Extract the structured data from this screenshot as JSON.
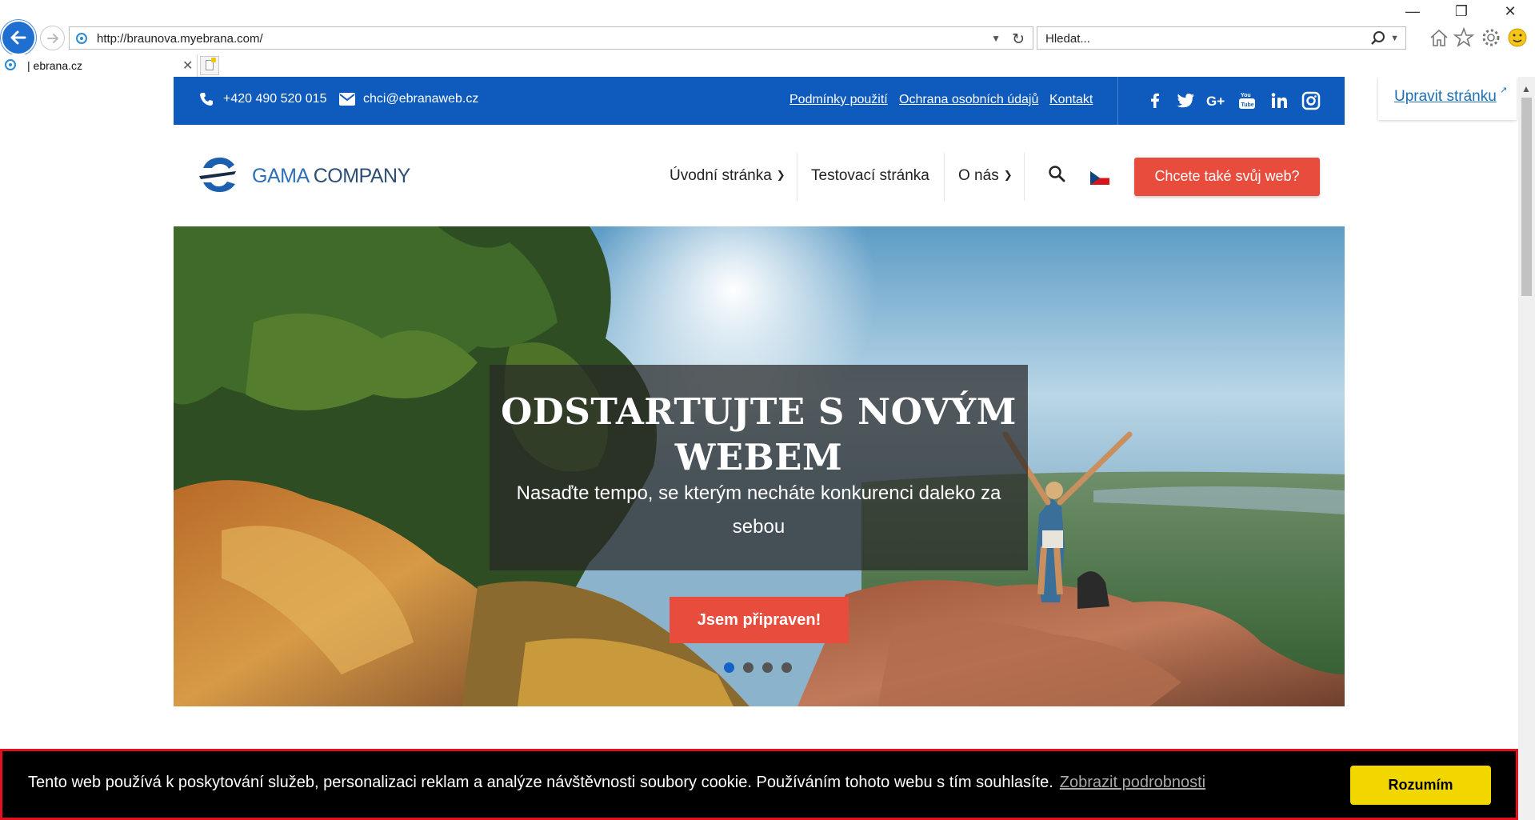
{
  "browser": {
    "url": "http://braunova.myebrana.com/",
    "search_placeholder": "Hledat...",
    "tab_title": "| ebrana.cz"
  },
  "edit_page": {
    "label": "Upravit stránku"
  },
  "topbar": {
    "phone": "+420 490 520 015",
    "email": "chci@ebranaweb.cz",
    "links": [
      "Podmínky použití",
      "Ochrana osobních údajů",
      "Kontakt"
    ],
    "social": [
      "facebook-icon",
      "twitter-icon",
      "google-plus-icon",
      "youtube-icon",
      "linkedin-icon",
      "instagram-icon"
    ]
  },
  "header": {
    "logo_text_1": "GAMA",
    "logo_text_2": " COMPANY",
    "nav": [
      "Úvodní stránka",
      "Testovací stránka",
      "O nás"
    ],
    "cta": "Chcete také svůj web?"
  },
  "hero": {
    "title": "ODSTARTUJTE S NOVÝM WEBEM",
    "subtitle": "Nasaďte tempo, se kterým necháte konkurenci daleko za sebou",
    "button": "Jsem připraven!",
    "slides": 4,
    "active_slide": 1
  },
  "cookie": {
    "text": "Tento web používá k poskytování služeb, personalizaci reklam a analýze návštěvnosti soubory cookie. Používáním tohoto webu s tím souhlasíte.",
    "link": "Zobrazit podrobnosti",
    "button": "Rozumím"
  },
  "colors": {
    "brand_blue": "#0e5bbd",
    "accent_red": "#e74c3c",
    "cookie_yellow": "#f1d600"
  }
}
